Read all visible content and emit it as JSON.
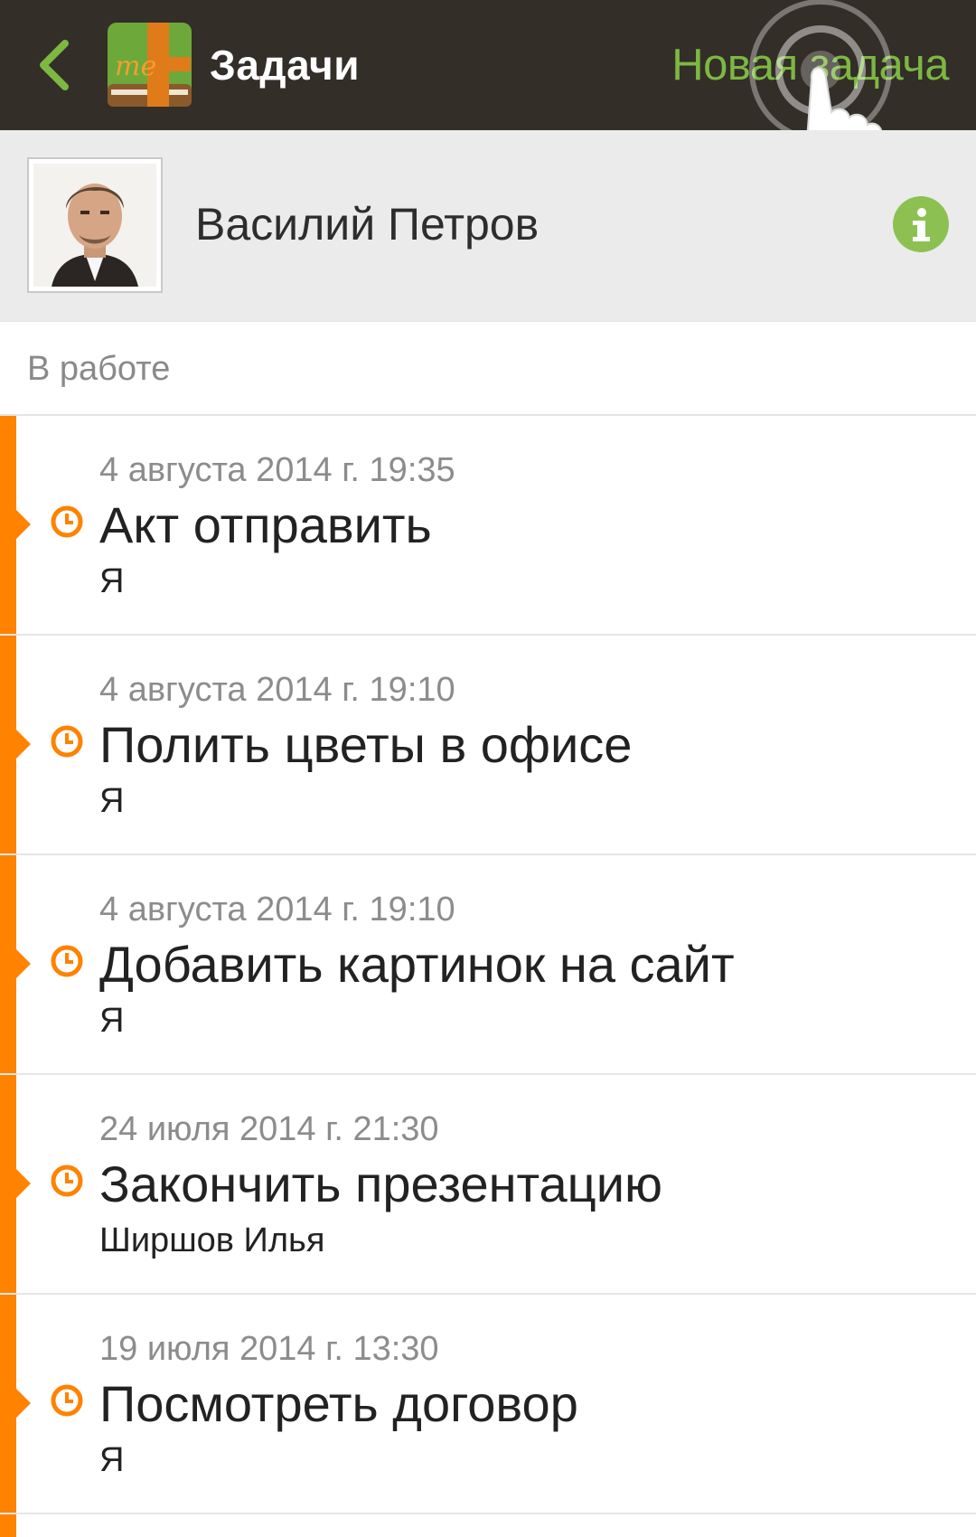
{
  "header": {
    "title": "Задачи",
    "new_task_label": "Новая задача",
    "colors": {
      "bar": "#332e28",
      "accent": "#7cb842"
    }
  },
  "profile": {
    "name": "Василий Петров",
    "info_icon": "info-icon"
  },
  "section": {
    "label": "В работе"
  },
  "tasks": [
    {
      "date": "4 августа 2014 г. 19:35",
      "title": "Акт отправить",
      "assignee": "Я"
    },
    {
      "date": "4 августа 2014 г. 19:10",
      "title": "Полить цветы в офисе",
      "assignee": "Я"
    },
    {
      "date": "4 августа 2014 г. 19:10",
      "title": "Добавить картинок на сайт",
      "assignee": "Я"
    },
    {
      "date": "24 июля 2014 г. 21:30",
      "title": "Закончить презентацию",
      "assignee": "Ширшов Илья"
    },
    {
      "date": "19 июля 2014 г. 13:30",
      "title": "Посмотреть договор",
      "assignee": "Я"
    }
  ],
  "task_status_color": "#ff8200"
}
